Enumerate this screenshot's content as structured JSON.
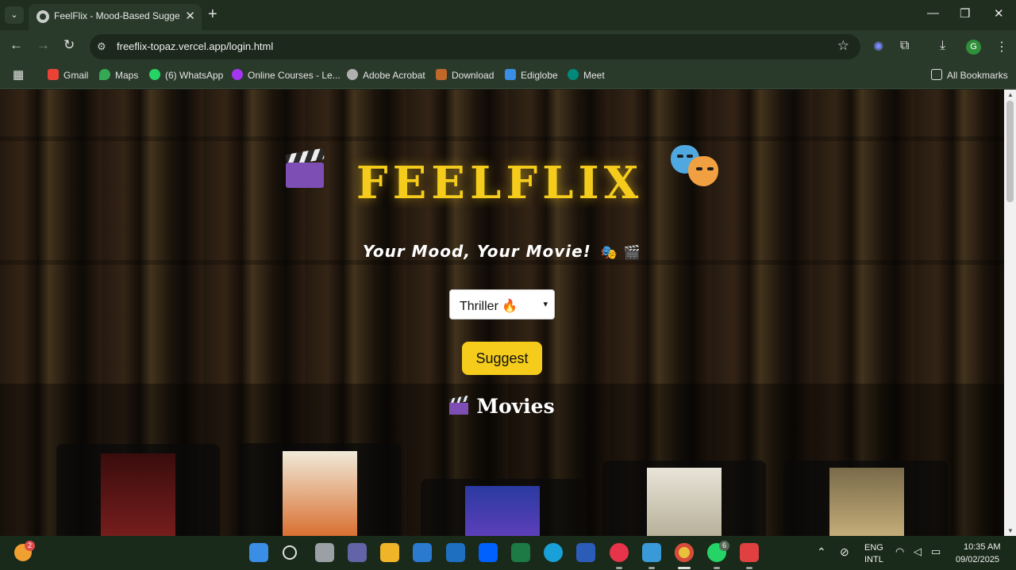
{
  "browser": {
    "tab_title": "FeelFlix - Mood-Based Suggestions",
    "tab_close": "✕",
    "new_tab": "+",
    "url": "freeflix-topaz.vercel.app/login.html",
    "profile_initial": "G",
    "window_controls": {
      "minimize": "—",
      "maximize": "❐",
      "close": "✕"
    }
  },
  "bookmarks": [
    {
      "label": "Gmail",
      "color": "#ea4335"
    },
    {
      "label": "Maps",
      "color": "#34a853"
    },
    {
      "label": "(6) WhatsApp",
      "color": "#25d366"
    },
    {
      "label": "Online Courses - Le...",
      "color": "#a435f0"
    },
    {
      "label": "Adobe Acrobat",
      "color": "#b0b0b0"
    },
    {
      "label": "Download",
      "color": "#c0682a"
    },
    {
      "label": "Ediglobe",
      "color": "#3a8ee6"
    },
    {
      "label": "Meet",
      "color": "#00897b"
    }
  ],
  "all_bookmarks": "All Bookmarks",
  "page": {
    "brand": "FEELFLIX",
    "tagline": "Your Mood, Your Movie!",
    "tagline_emojis": "🎭 🎬",
    "genre_select": {
      "value": "Thriller 🔥",
      "arrow": "▾"
    },
    "suggest_button": "Suggest",
    "movies_heading": "Movies"
  },
  "movies": [
    {
      "poster_color": "#7a1e1e"
    },
    {
      "poster_color": "#e8e0c8"
    },
    {
      "poster_color": "#3a4fb0"
    },
    {
      "poster_color": "#d8d2c0"
    },
    {
      "poster_color": "#b8a070"
    }
  ],
  "taskbar": {
    "weather_badge": "2",
    "whatsapp_badge": "6",
    "language": "ENG",
    "layout": "INTL",
    "time": "10:35 AM",
    "date": "09/02/2025"
  }
}
